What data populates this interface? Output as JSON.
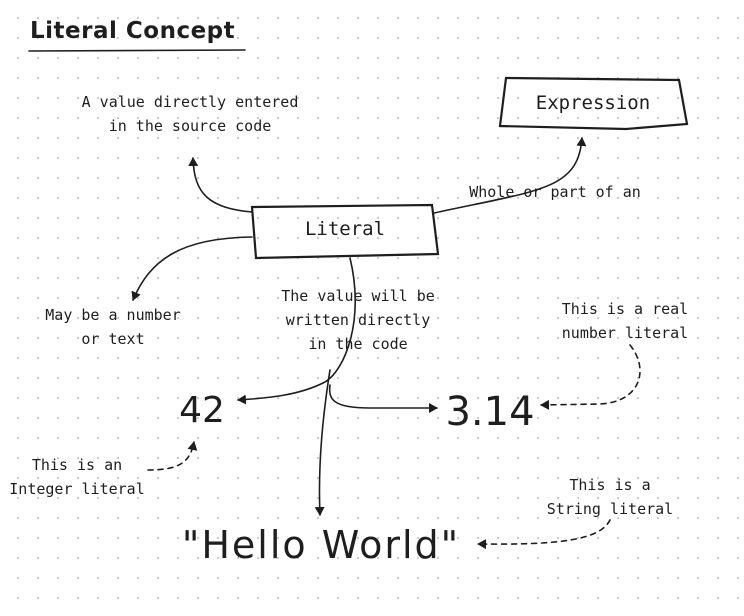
{
  "title": "Literal Concept",
  "nodes": {
    "literal": "Literal",
    "expression": "Expression"
  },
  "annotations": {
    "definition": "A value directly entered\nin the source code",
    "whole_or_part": "Whole or part of an",
    "number_or_text": "May be a number\nor text",
    "written_directly": "The value will be\nwritten directly\nin the code",
    "real_literal": "This is a real\nnumber literal",
    "integer_literal": "This is an\nInteger literal",
    "string_literal": "This is a\nString literal"
  },
  "examples": {
    "integer": "42",
    "real": "3.14",
    "string": "\"Hello World\""
  }
}
